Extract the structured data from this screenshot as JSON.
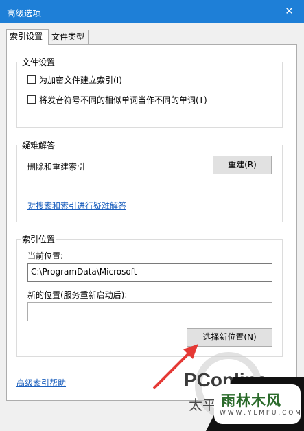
{
  "window": {
    "title": "高级选项",
    "close_label": "✕"
  },
  "tabs": [
    {
      "label": "索引设置"
    },
    {
      "label": "文件类型"
    }
  ],
  "file_settings": {
    "title": "文件设置",
    "options": [
      {
        "label": "为加密文件建立索引(I)",
        "checked": false
      },
      {
        "label": "将发音符号不同的相似单词当作不同的单词(T)",
        "checked": false
      }
    ]
  },
  "troubleshoot": {
    "title": "疑难解答",
    "rebuild_text": "删除和重建索引",
    "rebuild_button": "重建(R)",
    "help_link": "对搜索和索引进行疑难解答"
  },
  "index_location": {
    "title": "索引位置",
    "current_label": "当前位置:",
    "current_value": "C:\\ProgramData\\Microsoft",
    "new_label": "新的位置(服务重新启动后):",
    "new_value": "",
    "select_button": "选择新位置(N)"
  },
  "footer": {
    "advanced_help_link": "高级索引帮助"
  },
  "watermarks": {
    "pconline": "PConline",
    "pconline_sub": "太平洋",
    "ylmfu_main": "雨林木风",
    "ylmfu_url": "W W W . Y L M F U . C O M"
  },
  "colors": {
    "titlebar": "#1e7fd7",
    "link": "#1a5ebd",
    "arrow": "#e53935"
  }
}
